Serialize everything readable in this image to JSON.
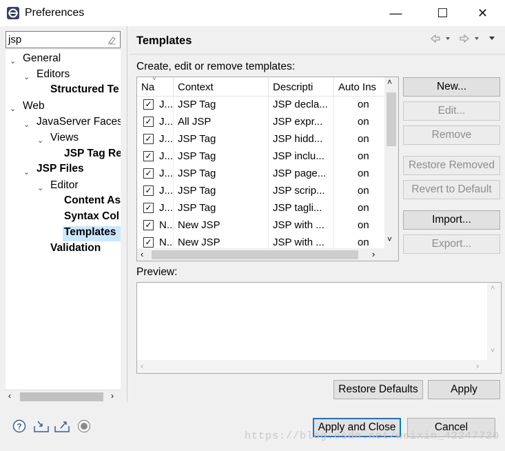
{
  "window": {
    "title": "Preferences",
    "minimize_glyph": "—",
    "maximize_glyph": "☐",
    "close_glyph": "✕"
  },
  "filter": {
    "value": "jsp",
    "clear_icon": "eraser-icon"
  },
  "tree": {
    "general": "General",
    "editors": "Editors",
    "structured": "Structured Te",
    "web": "Web",
    "jsf": "JavaServer Faces",
    "views": "Views",
    "jsp_tag": "JSP Tag Re",
    "jsp_files": "JSP Files",
    "editor": "Editor",
    "content_assist": "Content As",
    "syntax_coloring": "Syntax Col",
    "templates": "Templates",
    "validation": "Validation"
  },
  "page": {
    "title": "Templates",
    "description": "Create, edit or remove templates:",
    "preview_label": "Preview:"
  },
  "table": {
    "headers": [
      "Na",
      "Context",
      "Descripti",
      "Auto Ins"
    ],
    "rows": [
      {
        "name": "J...",
        "context": "JSP Tag",
        "desc": "JSP decla...",
        "auto": "on"
      },
      {
        "name": "J...",
        "context": "All JSP",
        "desc": "JSP expr...",
        "auto": "on"
      },
      {
        "name": "J...",
        "context": "JSP Tag",
        "desc": "JSP hidd...",
        "auto": "on"
      },
      {
        "name": "J...",
        "context": "JSP Tag",
        "desc": "JSP inclu...",
        "auto": "on"
      },
      {
        "name": "J...",
        "context": "JSP Tag",
        "desc": "JSP page...",
        "auto": "on"
      },
      {
        "name": "J...",
        "context": "JSP Tag",
        "desc": "JSP scrip...",
        "auto": "on"
      },
      {
        "name": "J...",
        "context": "JSP Tag",
        "desc": "JSP tagli...",
        "auto": "on"
      },
      {
        "name": "N...",
        "context": "New JSP",
        "desc": "JSP with ...",
        "auto": "on"
      },
      {
        "name": "N...",
        "context": "New JSP",
        "desc": "JSP with ...",
        "auto": "on"
      }
    ]
  },
  "buttons": {
    "new": "New...",
    "edit": "Edit...",
    "remove": "Remove",
    "restore_removed": "Restore Removed",
    "revert_default": "Revert to Default",
    "import": "Import...",
    "export": "Export...",
    "restore_defaults": "Restore Defaults",
    "apply": "Apply",
    "apply_close": "Apply and Close",
    "cancel": "Cancel"
  },
  "watermark": "https://blog.csdn.net/weixin_42247720"
}
